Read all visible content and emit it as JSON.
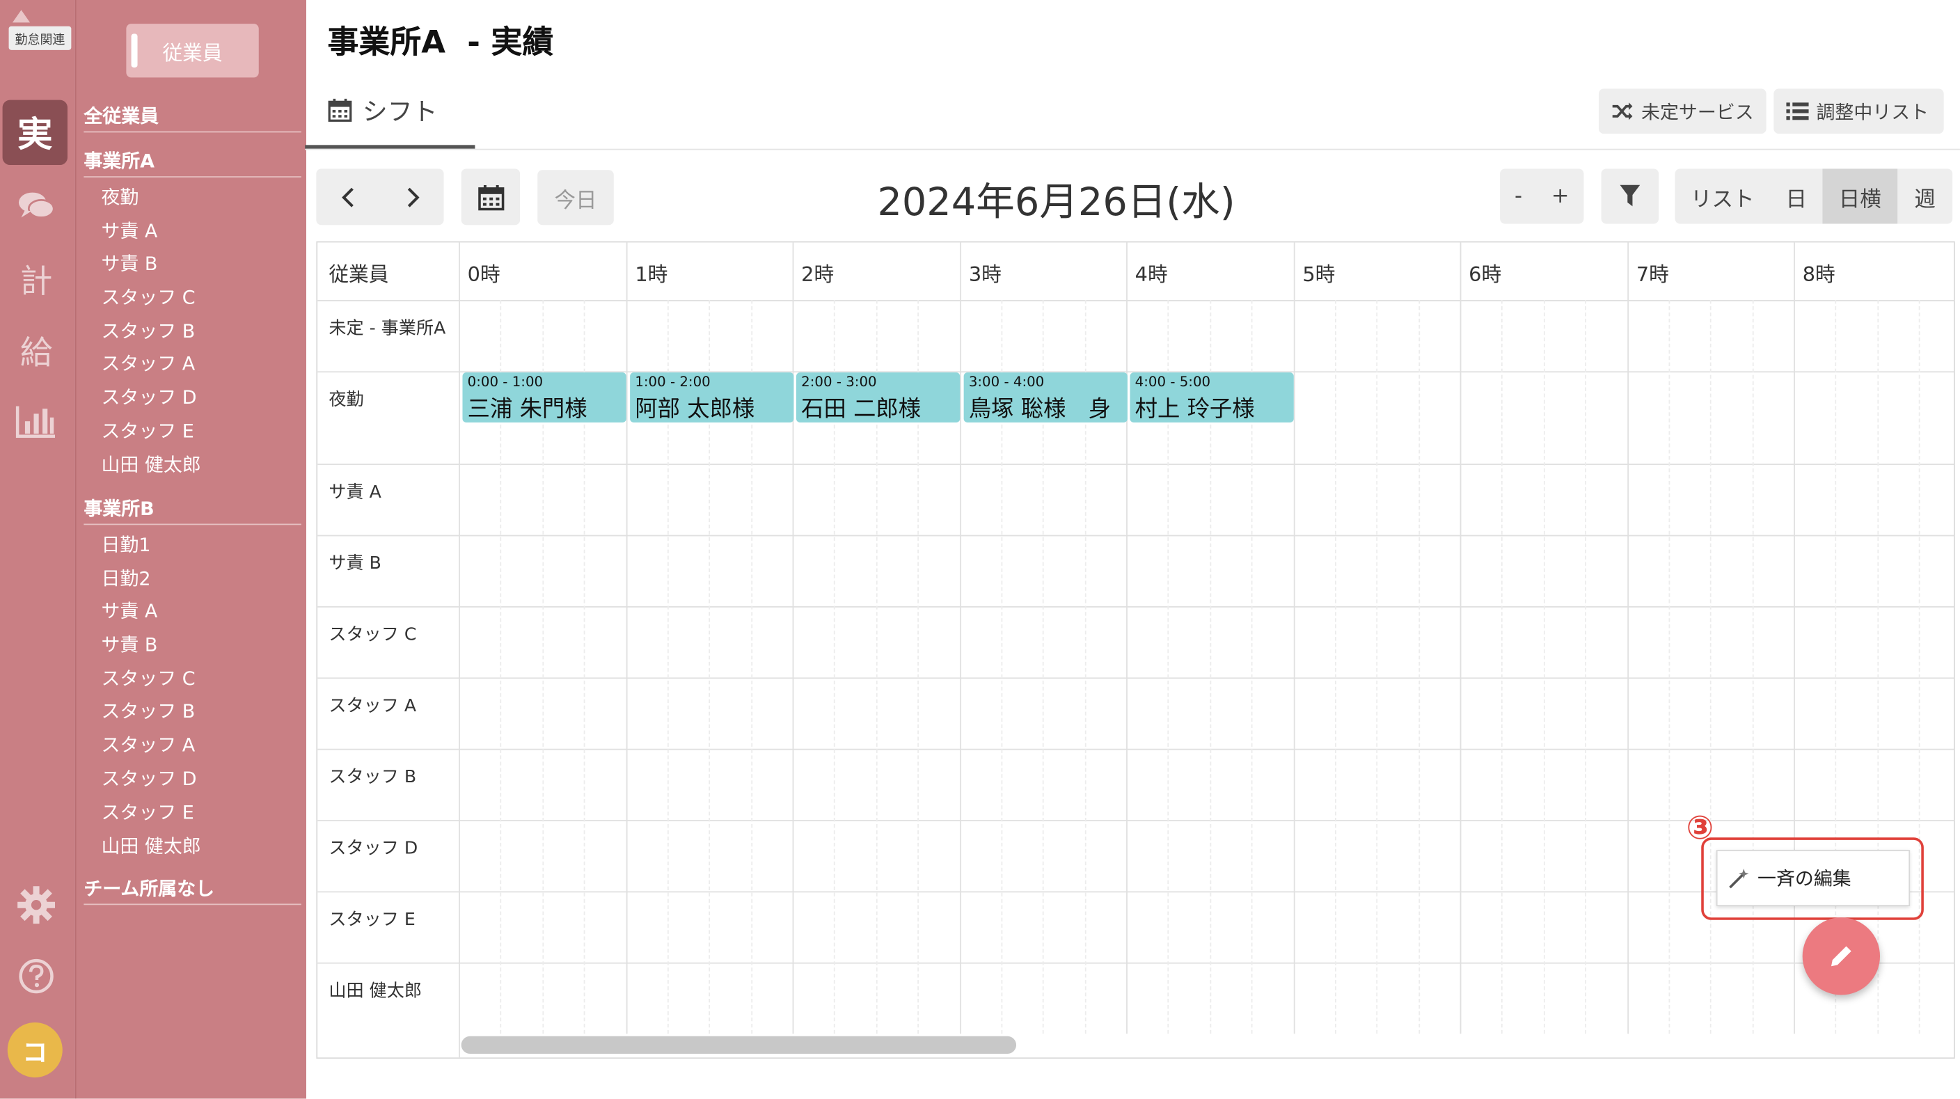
{
  "app": {
    "rail_tag": "勤怠関連",
    "rail_active": "実",
    "rail_items": [
      {
        "name": "chat-icon"
      },
      {
        "name": "plan-icon",
        "label": "計"
      },
      {
        "name": "payroll-icon",
        "label": "給"
      },
      {
        "name": "chart-icon"
      }
    ],
    "avatar_initial": "コ"
  },
  "sidebar": {
    "employee_button": "従業員",
    "all_employees": "全従業員",
    "groups": [
      {
        "label": "事業所A",
        "items": [
          "夜勤",
          "サ責 A",
          "サ責 B",
          "スタッフ C",
          "スタッフ B",
          "スタッフ A",
          "スタッフ D",
          "スタッフ E",
          "山田 健太郎"
        ]
      },
      {
        "label": "事業所B",
        "items": [
          "日勤1",
          "日勤2",
          "サ責 A",
          "サ責 B",
          "スタッフ C",
          "スタッフ B",
          "スタッフ A",
          "スタッフ D",
          "スタッフ E",
          "山田 健太郎"
        ]
      }
    ],
    "no_team": "チーム所属なし"
  },
  "header": {
    "title": "事業所A  - 実績",
    "tab_label": "シフト",
    "unassigned_services": "未定サービス",
    "adjusting_list": "調整中リスト"
  },
  "toolbar": {
    "today": "今日",
    "date": "2024年6月26日(水)",
    "zoom_out": "-",
    "zoom_in": "+",
    "views": [
      {
        "label": "リスト",
        "active": false
      },
      {
        "label": "日",
        "active": false
      },
      {
        "label": "日横",
        "active": true
      },
      {
        "label": "週",
        "active": false
      }
    ]
  },
  "schedule": {
    "employee_column": "従業員",
    "hours": [
      "0時",
      "1時",
      "2時",
      "3時",
      "4時",
      "5時",
      "6時",
      "7時",
      "8時"
    ],
    "rows": [
      "未定 - 事業所A",
      "夜勤",
      "サ責 A",
      "サ責 B",
      "スタッフ C",
      "スタッフ A",
      "スタッフ B",
      "スタッフ D",
      "スタッフ E",
      "山田 健太郎"
    ],
    "events": [
      {
        "row": "夜勤",
        "hour": 0,
        "time": "0:00 - 1:00",
        "name": "三浦 朱門様"
      },
      {
        "row": "夜勤",
        "hour": 1,
        "time": "1:00 - 2:00",
        "name": "阿部 太郎様"
      },
      {
        "row": "夜勤",
        "hour": 2,
        "time": "2:00 - 3:00",
        "name": "石田 二郎様"
      },
      {
        "row": "夜勤",
        "hour": 3,
        "time": "3:00 - 4:00",
        "name": "鳥塚 聡様　身"
      },
      {
        "row": "夜勤",
        "hour": 4,
        "time": "4:00 - 5:00",
        "name": "村上 玲子様"
      }
    ]
  },
  "callout": {
    "number": "③",
    "menu_item": "一斉の編集"
  },
  "colors": {
    "sidebar": "#c97f84",
    "event": "#8fd6da",
    "fab": "#ec7a80",
    "callout": "#e0413a"
  }
}
